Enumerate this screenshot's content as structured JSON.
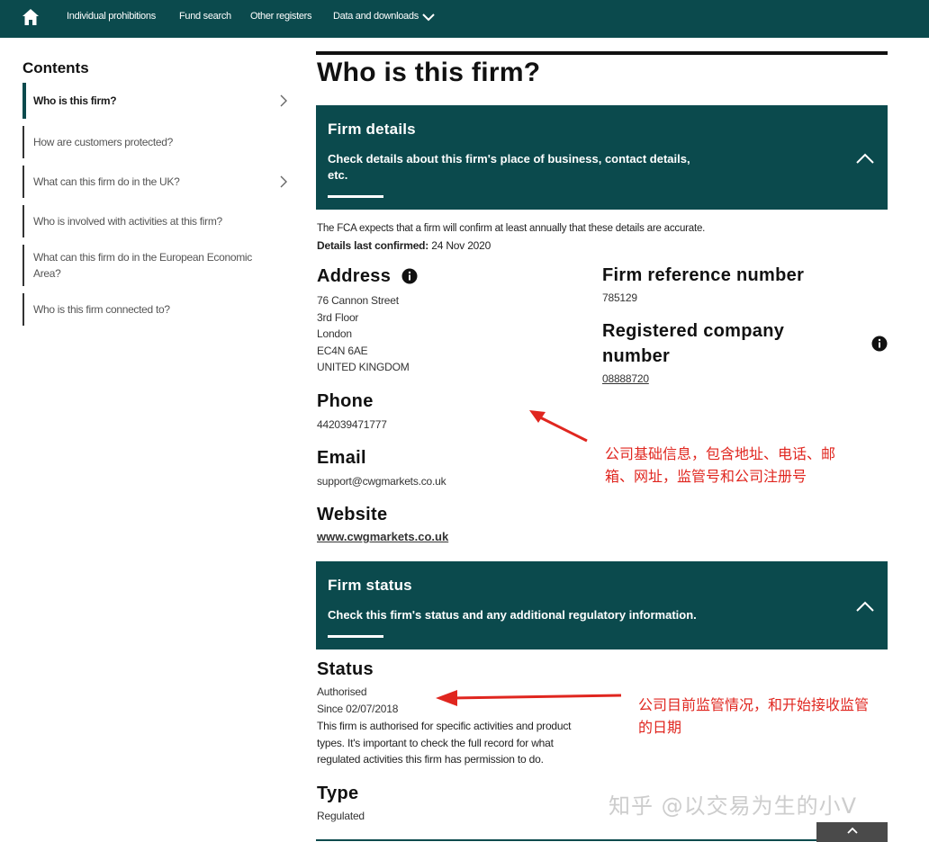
{
  "nav": {
    "items": [
      {
        "label": "Individual prohibitions"
      },
      {
        "label": "Fund search"
      },
      {
        "label": "Other registers"
      },
      {
        "label": "Data and downloads"
      }
    ]
  },
  "sidebar": {
    "title": "Contents",
    "items": [
      {
        "label": "Who is this firm?"
      },
      {
        "label": "How are customers protected?"
      },
      {
        "label": "What can this firm do in the UK?"
      },
      {
        "label": "Who is involved with activities at this firm?"
      },
      {
        "label": "What can this firm do in the European Economic Area?"
      },
      {
        "label": "Who is this firm connected to?"
      }
    ]
  },
  "page": {
    "title": "Who is this firm?"
  },
  "firm_details": {
    "title": "Firm details",
    "description": "Check details about this firm's place of business, contact details, etc.",
    "note": "The FCA expects that a firm will confirm at least annually that these details are accurate.",
    "confirmed_label": "Details last confirmed:",
    "confirmed_value": "24 Nov 2020",
    "address_heading": "Address",
    "address_lines": [
      "76 Cannon Street",
      "3rd Floor",
      "London",
      "EC4N 6AE",
      "UNITED KINGDOM"
    ],
    "phone_heading": "Phone",
    "phone": "442039471777",
    "email_heading": "Email",
    "email": "support@cwgmarkets.co.uk",
    "website_heading": "Website",
    "website": "www.cwgmarkets.co.uk",
    "frn_heading": "Firm reference number",
    "frn": "785129",
    "company_heading_1": "Registered company",
    "company_heading_2": "number",
    "company_number": "08888720"
  },
  "firm_status": {
    "title": "Firm status",
    "description": "Check this firm's status and any additional regulatory information.",
    "status_heading": "Status",
    "status": "Authorised",
    "since": "Since 02/07/2018",
    "explanation_lines": [
      "This firm is authorised for specific activities and product",
      "types. It's important to check the full record for what",
      "regulated activities this firm has permission to do."
    ],
    "type_heading": "Type",
    "type": "Regulated"
  },
  "annotations": {
    "note1_line1": "公司基础信息，包含地址、电话、邮",
    "note1_line2": "箱、网址，监管号和公司注册号",
    "note2_line1": "公司目前监管情况，和开始接收监管",
    "note2_line2": "的日期"
  },
  "watermark": "知乎 @以交易为生的小V",
  "colors": {
    "brand": "#0b4a4d",
    "annotation": "#e0261f"
  }
}
